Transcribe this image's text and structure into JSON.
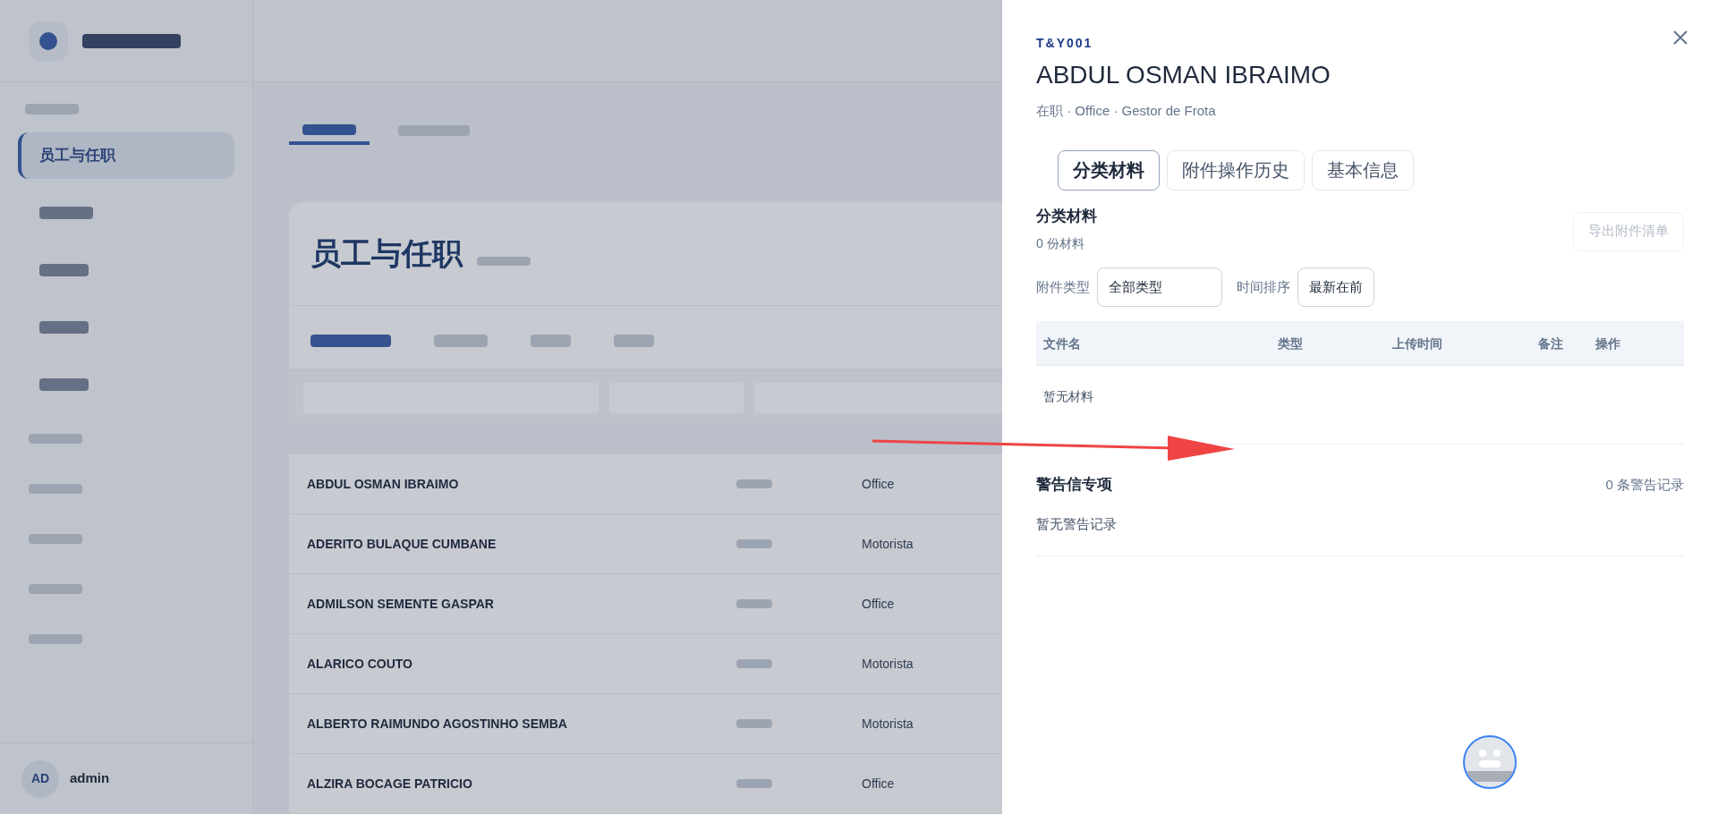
{
  "background": {
    "sidebar": {
      "active_item": "员工与任职",
      "user": {
        "initials": "AD",
        "name": "admin"
      }
    },
    "page": {
      "title": "员工与任职",
      "rows": [
        {
          "name": "ABDUL OSMAN IBRAIMO",
          "department": "Office"
        },
        {
          "name": "ADERITO BULAQUE CUMBANE",
          "department": "Motorista"
        },
        {
          "name": "ADMILSON SEMENTE GASPAR",
          "department": "Office"
        },
        {
          "name": "ALARICO COUTO",
          "department": "Motorista"
        },
        {
          "name": "ALBERTO RAIMUNDO AGOSTINHO SEMBA",
          "department": "Motorista"
        },
        {
          "name": "ALZIRA BOCAGE PATRICIO",
          "department": "Office"
        }
      ]
    }
  },
  "drawer": {
    "code": "T&Y001",
    "name": "ABDUL OSMAN IBRAIMO",
    "subtitle": "在职 · Office · Gestor de Frota",
    "tabs": [
      {
        "label": "分类材料",
        "selected": true
      },
      {
        "label": "附件操作历史",
        "selected": false
      },
      {
        "label": "基本信息",
        "selected": false
      }
    ],
    "materials": {
      "title": "分类材料",
      "count": "0 份材料",
      "export_button": {
        "label": "导出附件清单",
        "disabled": true
      },
      "filters": [
        {
          "label": "附件类型",
          "value": "全部类型"
        },
        {
          "label": "时间排序",
          "value": "最新在前"
        }
      ],
      "columns": [
        "文件名",
        "类型",
        "上传时间",
        "备注",
        "操作"
      ],
      "empty_text": "暂无材料"
    },
    "warnings": {
      "title": "警告信专项",
      "count": "0 条警告记录",
      "empty_text": "暂无警告记录"
    }
  }
}
